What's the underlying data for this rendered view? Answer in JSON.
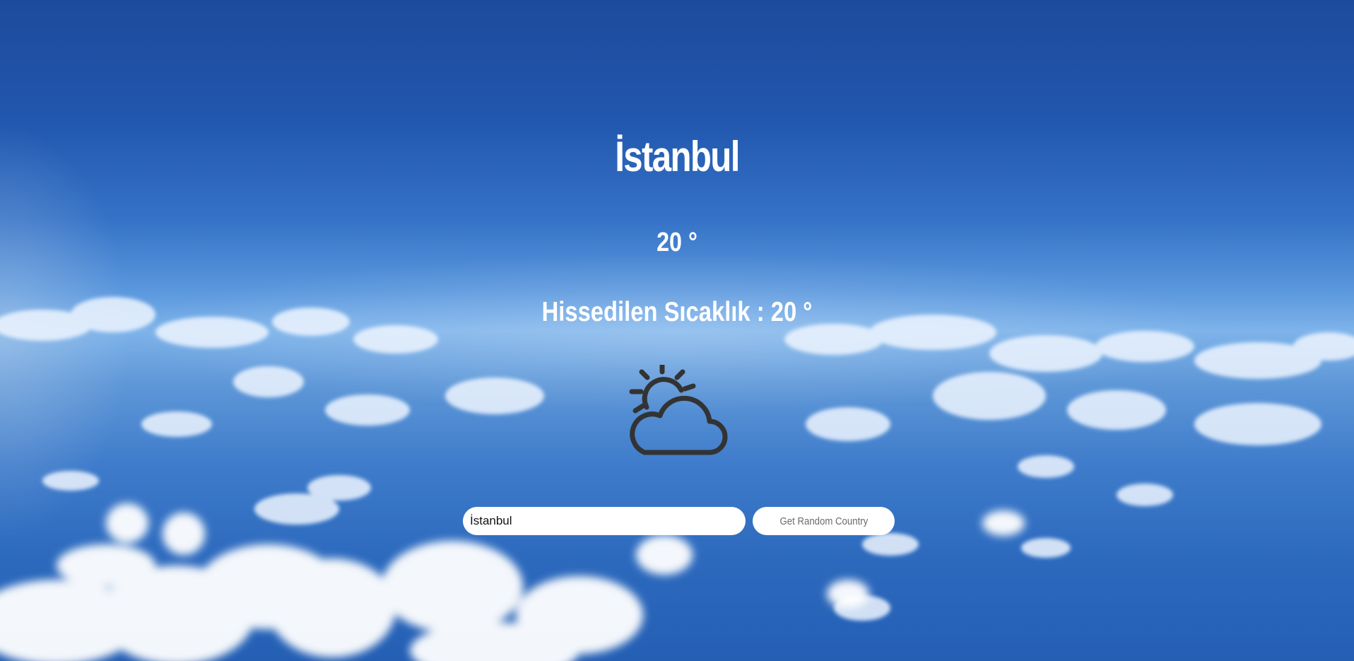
{
  "weather": {
    "city": "İstanbul",
    "temperature": "20 °",
    "feels_like": "Hissedilen Sıcaklık : 20 °",
    "icon": "partly-cloudy-icon"
  },
  "controls": {
    "search_value": "İstanbul",
    "random_button_label": "Get Random Country"
  },
  "colors": {
    "text": "#ffffff",
    "icon": "#333333",
    "button_text": "#6a6a6a"
  }
}
